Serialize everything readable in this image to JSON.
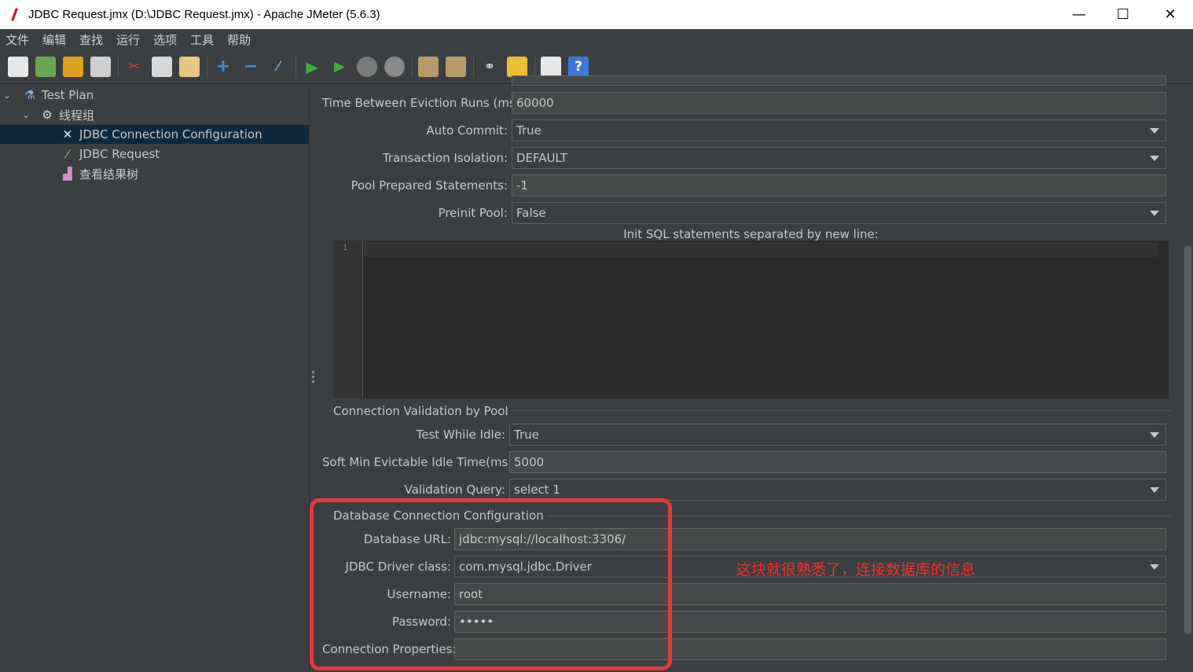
{
  "window": {
    "title": "JDBC Request.jmx (D:\\JDBC Request.jmx) - Apache JMeter (5.6.3)",
    "controls": [
      "—",
      "☐",
      "✕"
    ]
  },
  "menu": [
    "文件",
    "编辑",
    "查找",
    "运行",
    "选项",
    "工具",
    "帮助"
  ],
  "tree": {
    "test_plan": "Test Plan",
    "thread_group": "线程组",
    "jdbc_config": "JDBC Connection Configuration",
    "jdbc_request": "JDBC Request",
    "result_tree": "查看结果树"
  },
  "pool": {
    "eviction_label": "Time Between Eviction Runs (ms):",
    "eviction_value": "60000",
    "autocommit_label": "Auto Commit:",
    "autocommit_value": "True",
    "isolation_label": "Transaction Isolation:",
    "isolation_value": "DEFAULT",
    "prepared_label": "Pool Prepared Statements:",
    "prepared_value": "-1",
    "preinit_label": "Preinit Pool:",
    "preinit_value": "False",
    "init_sql_label": "Init SQL statements separated by new line:",
    "editor_line": "1"
  },
  "validation": {
    "section_title": "Connection Validation by Pool",
    "test_idle_label": "Test While Idle:",
    "test_idle_value": "True",
    "soft_min_label": "Soft Min Evictable Idle Time(ms):",
    "soft_min_value": "5000",
    "query_label": "Validation Query:",
    "query_value": "select 1"
  },
  "database": {
    "section_title": "Database Connection Configuration",
    "url_label": "Database URL:",
    "url_value": "jdbc:mysql://localhost:3306/",
    "driver_label": "JDBC Driver class:",
    "driver_value": "com.mysql.jdbc.Driver",
    "username_label": "Username:",
    "username_value": "root",
    "password_label": "Password:",
    "password_value": "•••••",
    "props_label": "Connection Properties:",
    "props_value": ""
  },
  "annotation": {
    "note": "这块就很熟悉了，连接数据库的信息",
    "color": "#e23a3a"
  }
}
